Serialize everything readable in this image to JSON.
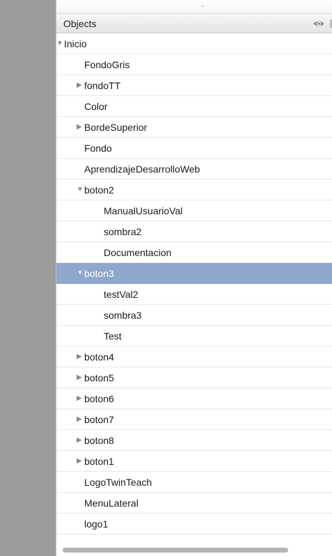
{
  "panel": {
    "header_title": "Objects",
    "header_icon": "eye-icon"
  },
  "tree": [
    {
      "label": "Inicio",
      "depth": 0,
      "toggle": "expanded"
    },
    {
      "label": "FondoGris",
      "depth": 1,
      "toggle": "none"
    },
    {
      "label": "fondoTT",
      "depth": 1,
      "toggle": "collapsed"
    },
    {
      "label": "Color",
      "depth": 1,
      "toggle": "none"
    },
    {
      "label": "BordeSuperior",
      "depth": 1,
      "toggle": "collapsed"
    },
    {
      "label": "Fondo",
      "depth": 1,
      "toggle": "none"
    },
    {
      "label": "AprendizajeDesarrolloWeb",
      "depth": 1,
      "toggle": "none"
    },
    {
      "label": "boton2",
      "depth": 1,
      "toggle": "expanded"
    },
    {
      "label": "ManualUsuarioVal",
      "depth": 2,
      "toggle": "none"
    },
    {
      "label": "sombra2",
      "depth": 2,
      "toggle": "none"
    },
    {
      "label": "Documentacion",
      "depth": 2,
      "toggle": "none"
    },
    {
      "label": "boton3",
      "depth": 1,
      "toggle": "expanded",
      "selected": true
    },
    {
      "label": "testVal2",
      "depth": 2,
      "toggle": "none"
    },
    {
      "label": "sombra3",
      "depth": 2,
      "toggle": "none"
    },
    {
      "label": "Test",
      "depth": 2,
      "toggle": "none"
    },
    {
      "label": "boton4",
      "depth": 1,
      "toggle": "collapsed"
    },
    {
      "label": "boton5",
      "depth": 1,
      "toggle": "collapsed"
    },
    {
      "label": "boton6",
      "depth": 1,
      "toggle": "collapsed"
    },
    {
      "label": "boton7",
      "depth": 1,
      "toggle": "collapsed"
    },
    {
      "label": "boton8",
      "depth": 1,
      "toggle": "collapsed"
    },
    {
      "label": "boton1",
      "depth": 1,
      "toggle": "collapsed"
    },
    {
      "label": "LogoTwinTeach",
      "depth": 1,
      "toggle": "none"
    },
    {
      "label": "MenuLateral",
      "depth": 1,
      "toggle": "none"
    },
    {
      "label": "logo1",
      "depth": 1,
      "toggle": "none"
    }
  ],
  "colors": {
    "selection": "#8fa7cc",
    "gutter": "#9c9c9c"
  }
}
